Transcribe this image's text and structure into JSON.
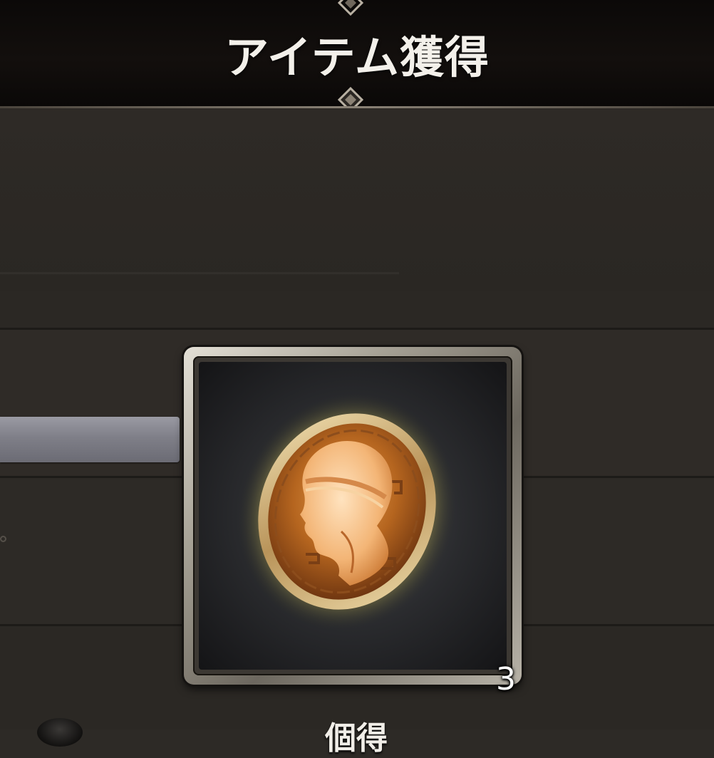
{
  "header": {
    "title": "アイテム獲得"
  },
  "reward": {
    "item_icon": "bronze-coin-icon",
    "quantity": "3",
    "subtitle": "個得"
  },
  "colors": {
    "background": "#2d2a26",
    "header": "#0b0908",
    "frame": "#a6a195",
    "coin_glow": "#f4e27a",
    "coin": "#c9772c"
  }
}
